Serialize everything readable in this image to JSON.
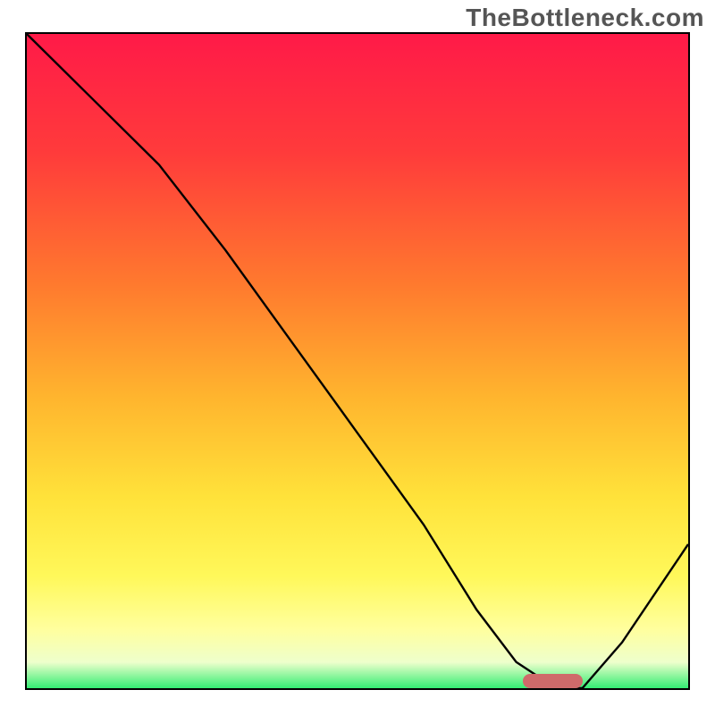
{
  "watermark": "TheBottleneck.com",
  "chart_data": {
    "type": "line",
    "title": "",
    "xlabel": "",
    "ylabel": "",
    "xlim": [
      0,
      100
    ],
    "ylim": [
      0,
      100
    ],
    "x": [
      0,
      10,
      20,
      30,
      40,
      50,
      60,
      68,
      74,
      80,
      84,
      90,
      100
    ],
    "values": [
      100,
      90,
      80,
      67,
      53,
      39,
      25,
      12,
      4,
      0,
      0,
      7,
      22
    ],
    "optimum_range": [
      75,
      84
    ],
    "gradient_stops": [
      {
        "pos": 0.0,
        "color": "#ff1a48"
      },
      {
        "pos": 0.18,
        "color": "#ff3b3b"
      },
      {
        "pos": 0.38,
        "color": "#ff7a2e"
      },
      {
        "pos": 0.55,
        "color": "#ffb52e"
      },
      {
        "pos": 0.7,
        "color": "#ffe23a"
      },
      {
        "pos": 0.82,
        "color": "#fff85a"
      },
      {
        "pos": 0.9,
        "color": "#ffff9e"
      },
      {
        "pos": 0.95,
        "color": "#eeffcc"
      },
      {
        "pos": 1.0,
        "color": "#00e85a"
      }
    ]
  },
  "colors": {
    "axis": "#000000",
    "curve": "#000000",
    "bar": "#cf6a6a",
    "text": "#555555"
  }
}
